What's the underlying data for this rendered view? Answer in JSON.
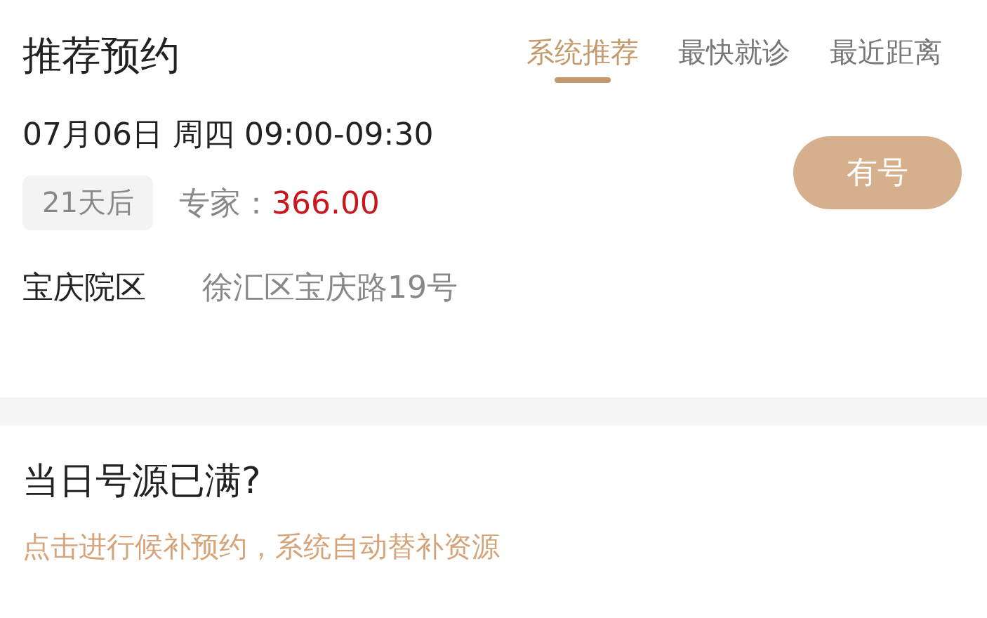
{
  "header": {
    "title": "推荐预约",
    "tabs": [
      {
        "label": "系统推荐",
        "selected": true
      },
      {
        "label": "最快就诊",
        "selected": false
      },
      {
        "label": "最近距离",
        "selected": false
      }
    ]
  },
  "slot": {
    "datetime": "07月06日 周四 09:00-09:30",
    "days_tag": "21天后",
    "fee_label": "专家：",
    "fee": "366.00",
    "button": "有号",
    "campus": "宝庆院区",
    "address": "徐汇区宝庆路19号"
  },
  "waitlist": {
    "title": "当日号源已满?",
    "link": "点击进行候补预约，系统自动替补资源"
  }
}
